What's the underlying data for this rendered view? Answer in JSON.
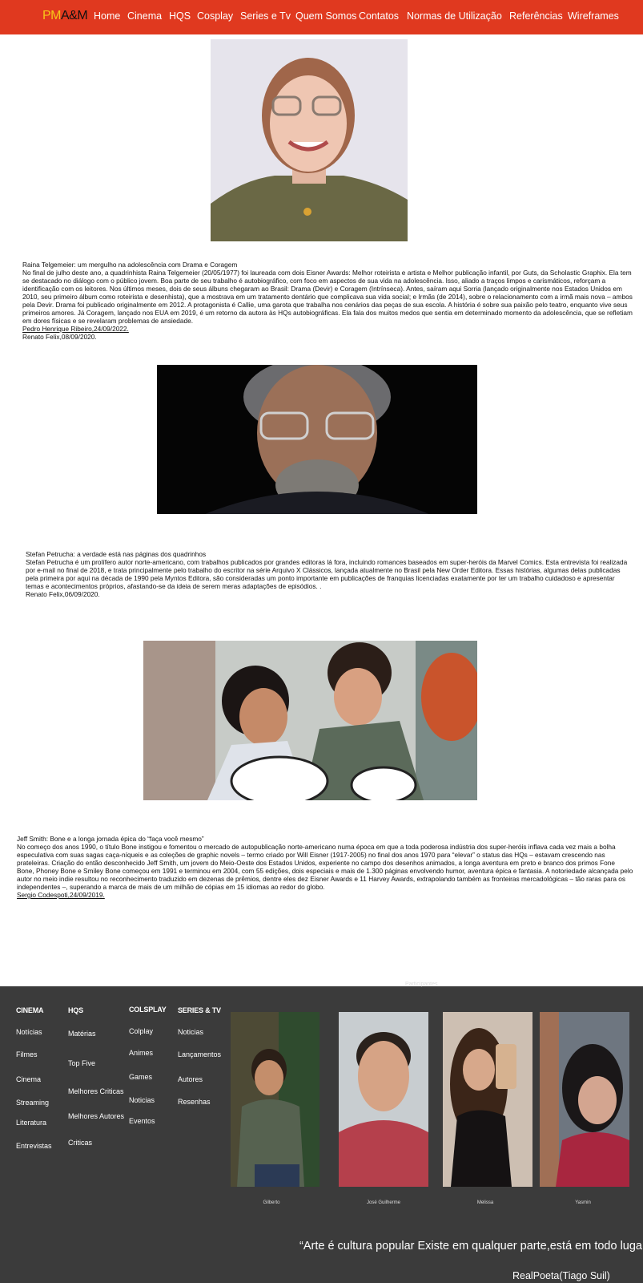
{
  "nav": {
    "logo_pm": "PM",
    "logo_am": "A&M",
    "items": [
      "Home",
      "Cinema",
      "HQS",
      "Cosplay",
      "Series e Tv",
      "Quem Somos",
      "Contatos",
      "Normas de Utilização",
      "Referências",
      "Wireframes"
    ]
  },
  "articles": [
    {
      "title": "Raina Telgemeier: um mergulho na adolescência com Drama e Coragem",
      "body": "No final de julho deste ano, a quadrinhista Raina Telgemeier (20/05/1977) foi laureada com dois Eisner Awards: Melhor roteirista e artista e Melhor publicação infantil, por Guts, da Scholastic Graphix. Ela tem se destacado no diálogo com o público jovem. Boa parte de seu trabalho é autobiográfico, com foco em aspectos de sua vida na adolescência. Isso, aliado a traços limpos e carismáticos, reforçam a identificação com os leitores. Nos últimos meses, dois de seus álbuns chegaram ao Brasil: Drama (Devir) e Coragem (Intrínseca). Antes, saíram aqui Sorria (lançado originalmente nos Estados Unidos em 2010, seu primeiro álbum como roteirista e desenhista), que a mostrava em um tratamento dentário que complicava sua vida social; e Irmãs (de 2014), sobre o relacionamento com a irmã mais nova – ambos pela Devir. Drama foi publicado originalmente em 2012. A protagonista é Callie, uma garota que trabalha nos cenários das peças de sua escola. A história é sobre sua paixão pelo teatro, enquanto vive seus primeiros amores. Já Coragem, lançado nos EUA em 2019, é um retorno da autora às HQs autobiográficas. Ela fala dos muitos medos que sentia em determinado momento da adolescência, que se refletiam em dores físicas e se revelaram problemas de ansiedade.",
      "credit1": "Pedro Henrique Ribeiro,24/09/2022.",
      "credit2": "Renato Felix,08/09/2020."
    },
    {
      "title": "Stefan Petrucha: a verdade está nas páginas dos quadrinhos",
      "body": "Stefan Petrucha é um prolífero autor norte-americano, com trabalhos publicados por grandes editoras lá fora, incluindo romances baseados em super-heróis da Marvel Comics. Esta entrevista foi realizada por e-mail no final de 2018, e trata principalmente pelo trabalho do escritor na série Arquivo X Clássicos, lançada atualmente no Brasil pela New Order Editora. Essas histórias, algumas delas publicadas pela primeira por aqui na década de 1990 pela Myntos Editora, são consideradas um ponto importante em publicações de franquias licenciadas exatamente por ter um trabalho cuidadoso e apresentar temas e acontecimentos próprios, afastando-se da ideia de serem meras adaptações de episódios. .",
      "credit1": "Renato Felix,06/09/2020."
    },
    {
      "title": "Jeff Smith: Bone e a longa jornada épica do “faça você mesmo”",
      "body": "No começo dos anos 1990, o título Bone instigou e fomentou o mercado de autopublicação norte-americano numa época em que a toda poderosa indústria dos super-heróis inflava cada vez mais a bolha especulativa com suas sagas caça-níqueis e as coleções de graphic novels – termo criado por Will Eisner (1917-2005) no final dos anos 1970 para “elevar” o status das HQs – estavam crescendo nas prateleiras. Criação do então desconhecido Jeff Smith, um jovem do Meio-Oeste dos Estados Unidos, experiente no campo dos desenhos animados, a longa aventura em preto e branco dos primos Fone Bone, Phoney Bone e Smiley Bone começou em 1991 e terminou em 2004, com 55 edições, dois especiais e mais de 1.300 páginas envolvendo humor, aventura épica e fantasia. A notoriedade alcançada pelo autor no meio indie resultou no reconhecimento traduzido em dezenas de prêmios, dentre eles dez Eisner Awards e 11 Harvey Awards, extrapolando também as fronteiras mercadológicas – tão raras para os independentes –, superando a marca de mais de um milhão de cópias em 15 idiomas ao redor do globo.",
      "credit1": "Sergio Codespoti,24/09/2019."
    }
  ],
  "footer": {
    "participants_label": "Participantes",
    "columns": [
      {
        "heading": "CINEMA",
        "links": [
          "Notícias",
          "Filmes",
          "Cinema",
          "Streaming",
          "Literatura",
          "Entrevistas"
        ]
      },
      {
        "heading": "HQS",
        "links": [
          "Matérias",
          "Top Five",
          "Melhores Criticas",
          "Melhores Autores",
          "Criticas"
        ]
      },
      {
        "heading": "COLSPLAY",
        "links": [
          "Colplay",
          "Animes",
          "Games",
          "Noticias",
          "Eventos"
        ]
      },
      {
        "heading": "SERIES & TV",
        "links": [
          "Noticias",
          "Lançamentos",
          "Autores",
          "Resenhas"
        ]
      }
    ],
    "people": [
      "Gilberto",
      "José Guilherme",
      "Melissa",
      "Yasmin"
    ],
    "quote": "“Arte é cultura popular Existe em qualquer parte,está em todo lugar.”",
    "author": "RealPoeta(Tiago Suil)"
  }
}
